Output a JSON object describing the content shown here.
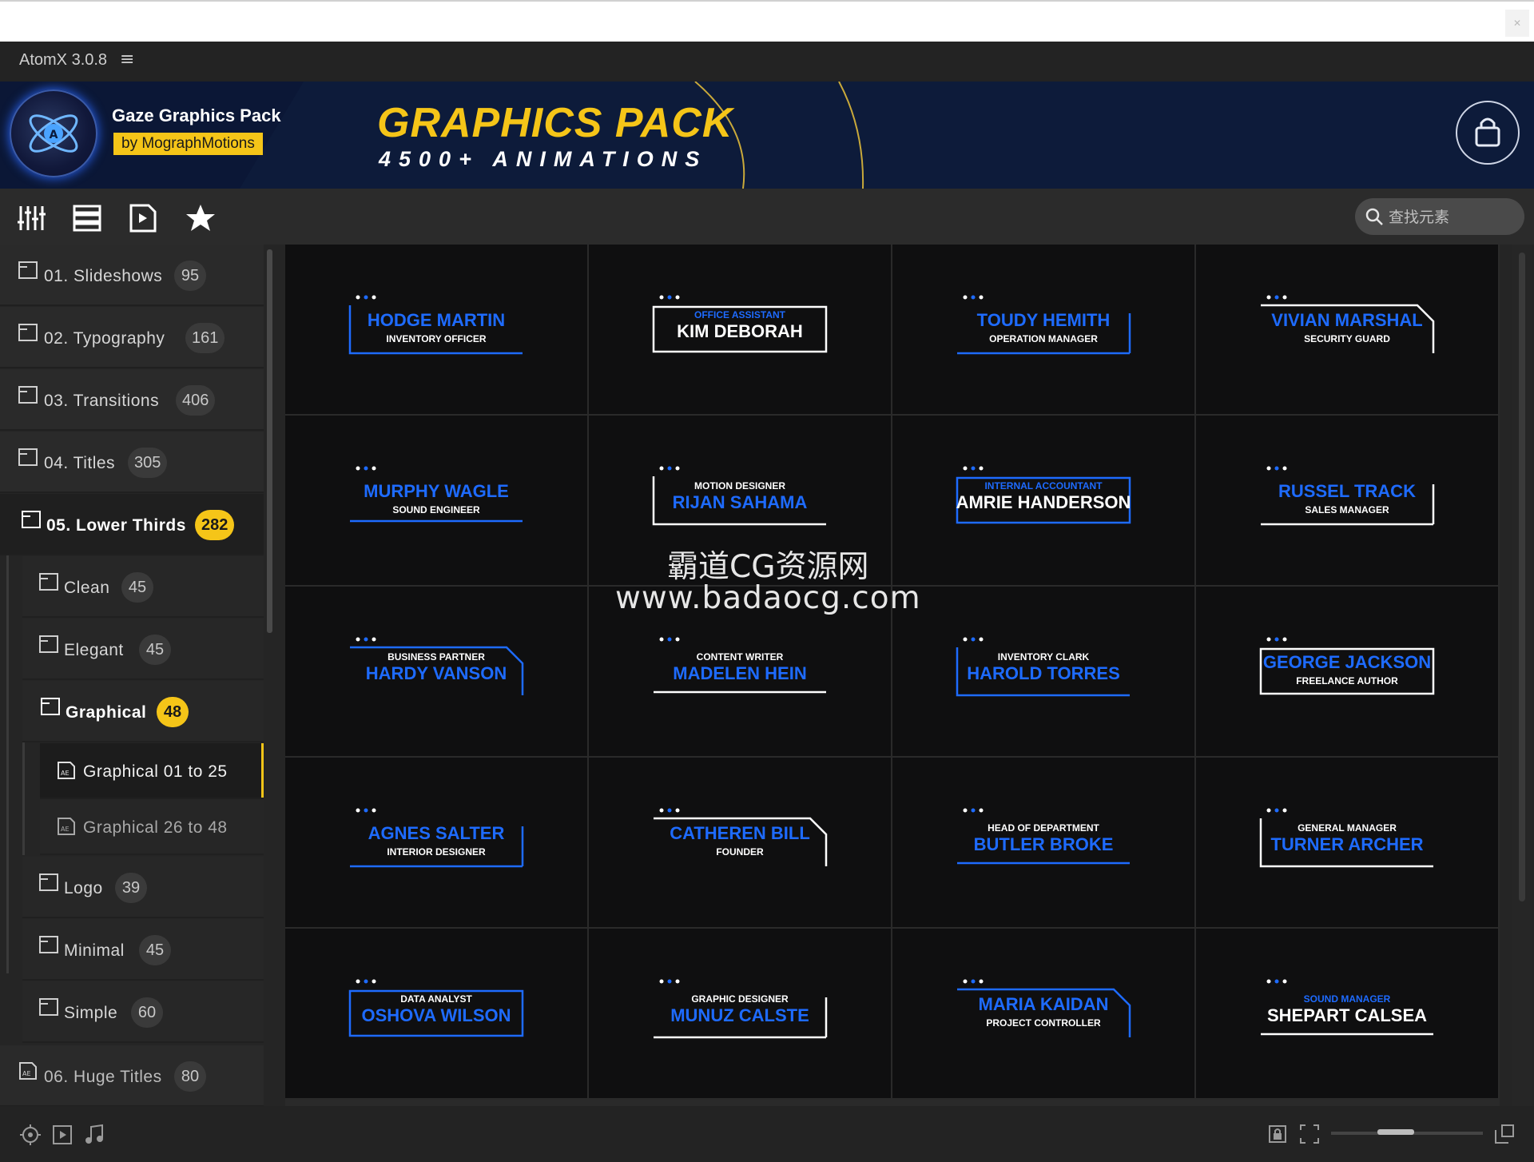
{
  "window": {
    "title": "AtomX 3.0.8",
    "menu_icon": "hamburger-icon",
    "close_icon": "close-icon"
  },
  "banner": {
    "pack_name": "Gaze Graphics Pack",
    "by_label": "by MographMotions",
    "headline": "GRAPHICS PACK",
    "subheadline": "4500+ ANIMATIONS",
    "cart_icon": "shopping-bag-icon"
  },
  "toolbar": {
    "icons": [
      "sliders-icon",
      "list-icon",
      "play-file-icon",
      "star-icon"
    ],
    "search_placeholder": "查找元素"
  },
  "sidebar": {
    "items": [
      {
        "label": "01. Slideshows",
        "count": "95"
      },
      {
        "label": "02. Typography",
        "count": "161"
      },
      {
        "label": "03. Transitions",
        "count": "406"
      },
      {
        "label": "04. Titles",
        "count": "305"
      },
      {
        "label": "05. Lower Thirds",
        "count": "282",
        "expanded": true,
        "children": [
          {
            "label": "Clean",
            "count": "45"
          },
          {
            "label": "Elegant",
            "count": "45"
          },
          {
            "label": "Graphical",
            "count": "48",
            "expanded": true,
            "children": [
              {
                "label": "Graphical 01 to 25",
                "selected": true
              },
              {
                "label": "Graphical 26 to 48"
              }
            ]
          },
          {
            "label": "Logo",
            "count": "39"
          },
          {
            "label": "Minimal",
            "count": "45"
          },
          {
            "label": "Simple",
            "count": "60"
          }
        ]
      },
      {
        "label": "06. Huge Titles",
        "count": "80"
      }
    ]
  },
  "grid": {
    "tiles": [
      {
        "top": "HODGE MARTIN",
        "sub": "INVENTORY OFFICER"
      },
      {
        "top": "OFFICE ASSISTANT",
        "sub": "KIM DEBORAH"
      },
      {
        "top": "TOUDY HEMITH",
        "sub": "OPERATION MANAGER"
      },
      {
        "top": "VIVIAN MARSHAL",
        "sub": "SECURITY GUARD"
      },
      {
        "top": "MURPHY WAGLE",
        "sub": "SOUND ENGINEER"
      },
      {
        "top": "MOTION DESIGNER",
        "sub": "RIJAN SAHAMA"
      },
      {
        "top": "INTERNAL ACCOUNTANT",
        "sub": "AMRIE HANDERSON"
      },
      {
        "top": "RUSSEL TRACK",
        "sub": "SALES MANAGER"
      },
      {
        "top": "BUSINESS PARTNER",
        "sub": "HARDY VANSON"
      },
      {
        "top": "CONTENT WRITER",
        "sub": "MADELEN HEIN"
      },
      {
        "top": "INVENTORY CLARK",
        "sub": "HAROLD TORRES"
      },
      {
        "top": "GEORGE JACKSON",
        "sub": "FREELANCE AUTHOR"
      },
      {
        "top": "AGNES SALTER",
        "sub": "INTERIOR DESIGNER"
      },
      {
        "top": "CATHEREN BILL",
        "sub": "FOUNDER"
      },
      {
        "top": "HEAD OF DEPARTMENT",
        "sub": "BUTLER BROKE"
      },
      {
        "top": "GENERAL MANAGER",
        "sub": "TURNER ARCHER"
      },
      {
        "top": "DATA ANALYST",
        "sub": "OSHOVA WILSON"
      },
      {
        "top": "GRAPHIC DESIGNER",
        "sub": "MUNUZ CALSTE"
      },
      {
        "top": "MARIA KAIDAN",
        "sub": "PROJECT CONTROLLER"
      },
      {
        "top": "SOUND MANAGER",
        "sub": "SHEPART CALSEA"
      }
    ]
  },
  "watermark": {
    "line1": "霸道CG资源网",
    "line2": "www.badaocg.com"
  },
  "footer": {
    "left_icons": [
      "target-icon",
      "video-icon",
      "music-note-icon"
    ],
    "right_icons": [
      "lock-icon",
      "fit-frame-icon",
      "expand-icon"
    ],
    "zoom_level": 0.4
  },
  "colors": {
    "accent": "#f5c518",
    "blue": "#1e6bff",
    "bg": "#252525",
    "tile_bg": "#0f0f10"
  }
}
